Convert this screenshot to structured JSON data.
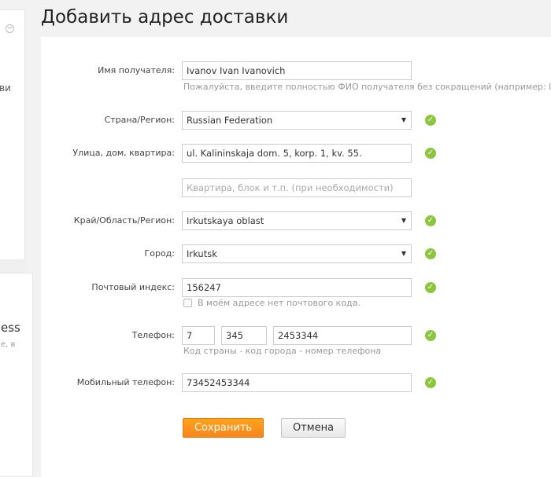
{
  "title": "Добавить адрес доставки",
  "left": {
    "partial_text_1": "ви",
    "partial_title_2": "ess",
    "partial_text_2": "е, в"
  },
  "form": {
    "name": {
      "label": "Имя получателя:",
      "value": "Ivanov Ivan Ivanovich",
      "hint": "Пожалуйста, введите полностью ФИО получателя без сокращений (например: Iva"
    },
    "country": {
      "label": "Страна/Регион:",
      "value": "Russian Federation"
    },
    "street": {
      "label": "Улица, дом, квартира:",
      "value": "ul. Kalininskaja dom. 5, korp. 1, kv. 55.",
      "placeholder2": "Квартира, блок и т.п. (при необходимости)"
    },
    "region": {
      "label": "Край/Область/Регион:",
      "value": "Irkutskaya oblast"
    },
    "city": {
      "label": "Город:",
      "value": "Irkutsk"
    },
    "zip": {
      "label": "Почтовый индекс:",
      "value": "156247",
      "checkbox_label": "В моём адресе нет почтового кода.",
      "checked": false
    },
    "phone": {
      "label": "Телефон:",
      "country": "7",
      "city": "345",
      "number": "2453344",
      "hint": "Код страны - код города - номер телефона"
    },
    "mobile": {
      "label": "Мобильный телефон:",
      "value": "73452453344"
    }
  },
  "buttons": {
    "save": "Сохранить",
    "cancel": "Отмена"
  },
  "colors": {
    "accent": "#f7931e",
    "valid": "#8cc63f"
  }
}
